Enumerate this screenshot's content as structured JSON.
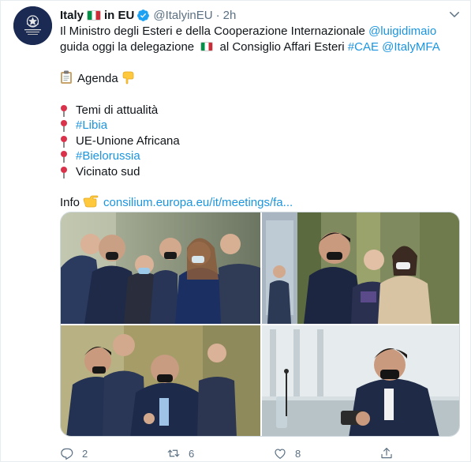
{
  "author": {
    "name": "Italy",
    "name_suffix": "in EU",
    "handle": "@ItalyinEU",
    "separator": "·",
    "time": "2h"
  },
  "tweet": {
    "line1_text": "Il Ministro degli Esteri e della Cooperazione Internazionale ",
    "line1_mention": "@luigidimaio",
    "line2_text_a": "guida oggi la delegazione ",
    "line2_text_b": " al Consiglio Affari Esteri ",
    "line2_tag": "#CAE",
    "line2_mention": "@ItalyMFA",
    "agenda_label": "Agenda",
    "agenda_items": [
      {
        "text": "Temi di attualità",
        "is_link": false
      },
      {
        "text": "#Libia",
        "is_link": true
      },
      {
        "text": "UE-Unione Africana",
        "is_link": false
      },
      {
        "text": "#Bielorussia",
        "is_link": true
      },
      {
        "text": "Vicinato sud",
        "is_link": false
      }
    ],
    "info_label": "Info",
    "info_link": "consilium.europa.eu/it/meetings/fa..."
  },
  "media": {
    "photo_count": 4
  },
  "actions": {
    "reply_count": "2",
    "retweet_count": "6",
    "like_count": "8"
  },
  "colors": {
    "link": "#1b95e0",
    "muted": "#5b7083",
    "verified": "#1da1f2"
  },
  "icons": [
    "caret-down-icon",
    "verified-badge-icon",
    "clipboard-icon",
    "hand-down-icon",
    "pushpin-icon",
    "hand-right-icon",
    "reply-icon",
    "retweet-icon",
    "like-icon",
    "share-icon"
  ]
}
